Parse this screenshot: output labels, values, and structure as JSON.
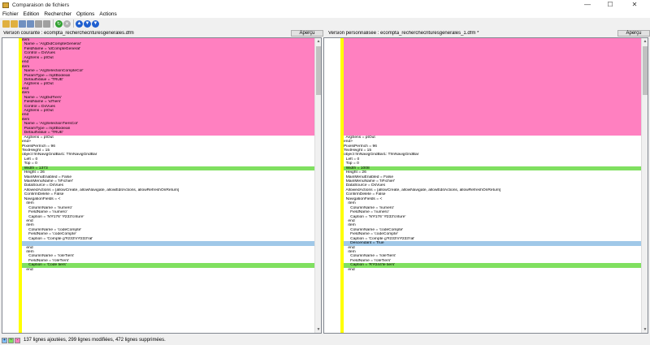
{
  "window": {
    "title": "Comparaison de fichiers",
    "minimize": "—",
    "maximize": "☐",
    "close": "✕"
  },
  "menu": [
    "Fichier",
    "Edition",
    "Rechercher",
    "Options",
    "Actions"
  ],
  "toolbar": {
    "icons": [
      "open-icon",
      "save-icon",
      "save-as-icon",
      "swap-icon",
      "copy-icon",
      "refresh-icon",
      "cancel-icon",
      "prev-diff-icon",
      "next-diff-icon",
      "last-diff-icon"
    ]
  },
  "left": {
    "label": "Version courante : ecompta_recherchecrituresgenerales.dfm",
    "apercu": "Aperçu",
    "lines": [
      {
        "t": "item",
        "bg": "#ff80c0"
      },
      {
        "t": "  Name = 'ArgDidCompteGeneral'",
        "bg": "#ff80c0"
      },
      {
        "t": "  FieldName = 'idCompteGeneral'",
        "bg": "#ff80c0"
      },
      {
        "t": "  Control = DxVues",
        "bg": "#ff80c0"
      },
      {
        "t": "  ArgSens = ptOut",
        "bg": "#ff80c0"
      },
      {
        "t": "end",
        "bg": "#ff80c0"
      },
      {
        "t": "item",
        "bg": "#ff80c0"
      },
      {
        "t": "  Name = 'ArgSelectionCompteCol'",
        "bg": "#ff80c0"
      },
      {
        "t": "  ParamType = mptBoolean",
        "bg": "#ff80c0"
      },
      {
        "t": "  DefaultValue = 'TRUE'",
        "bg": "#ff80c0"
      },
      {
        "t": "  ArgSens = ptOut",
        "bg": "#ff80c0"
      },
      {
        "t": "end",
        "bg": "#ff80c0"
      },
      {
        "t": "item",
        "bg": "#ff80c0"
      },
      {
        "t": "  Name = 'ArgDidTiers'",
        "bg": "#ff80c0"
      },
      {
        "t": "  FieldName = 'idTiers'",
        "bg": "#ff80c0"
      },
      {
        "t": "  Control = DxVues",
        "bg": "#ff80c0"
      },
      {
        "t": "  ArgSens = ptOut",
        "bg": "#ff80c0"
      },
      {
        "t": "end",
        "bg": "#ff80c0"
      },
      {
        "t": "item",
        "bg": "#ff80c0"
      },
      {
        "t": "  Name = 'ArgSelectionTiersCol'",
        "bg": "#ff80c0"
      },
      {
        "t": "  ParamType = mptBoolean",
        "bg": "#ff80c0"
      },
      {
        "t": "  DefaultValue = 'TRUE'",
        "bg": "#ff80c0"
      },
      {
        "t": "  ArgSens = ptOut",
        "bg": ""
      },
      {
        "t": "end>",
        "bg": ""
      },
      {
        "t": "PixelsPerInch = 96",
        "bg": ""
      },
      {
        "t": "TextHeight = 15",
        "bg": ""
      },
      {
        "t": "object fmNavigGridBar1: TfmNavigGridBar",
        "bg": ""
      },
      {
        "t": "  Left = 0",
        "bg": ""
      },
      {
        "t": "  Top = 0",
        "bg": ""
      },
      {
        "t": "  Width = 1373",
        "bg": "#80e060"
      },
      {
        "t": "  Height = 26",
        "bg": ""
      },
      {
        "t": "  MainMenuEnabled = False",
        "bg": ""
      },
      {
        "t": "  MainMenuName = 'fiFichier'",
        "bg": ""
      },
      {
        "t": "  DataSource = DsVues",
        "bg": ""
      },
      {
        "t": "  AllowedActions = [allowCreate, allowNavigate, allowEditActions, allowRefreshOnReturn]",
        "bg": ""
      },
      {
        "t": "  ConfirmDelete = False",
        "bg": ""
      },
      {
        "t": "  NavigationFields = <",
        "bg": ""
      },
      {
        "t": "    item",
        "bg": ""
      },
      {
        "t": "      ColumnName = 'numero'",
        "bg": ""
      },
      {
        "t": "      FieldName = 'numero'",
        "bg": ""
      },
      {
        "t": "      Caption = 'N'#176' '#233'criture'",
        "bg": ""
      },
      {
        "t": "    end",
        "bg": ""
      },
      {
        "t": "    item",
        "bg": ""
      },
      {
        "t": "      ColumnName = 'codeCompte'",
        "bg": ""
      },
      {
        "t": "      FieldName = 'codeCompte'",
        "bg": ""
      },
      {
        "t": "      Caption = 'Compte g'#233'n'#233'ral'",
        "bg": ""
      },
      {
        "t": "",
        "bg": "#a0c8e8"
      },
      {
        "t": "    end",
        "bg": ""
      },
      {
        "t": "    item",
        "bg": ""
      },
      {
        "t": "      ColumnName = 'roleTiers'",
        "bg": ""
      },
      {
        "t": "      FieldName = 'roleTiers'",
        "bg": ""
      },
      {
        "t": "      Caption = 'Code tiers'",
        "bg": "#80e060"
      },
      {
        "t": "    end",
        "bg": ""
      }
    ]
  },
  "right": {
    "label": "Version personnalisée : ecompta_recherchecrituresgenerales_1.dfm *",
    "apercu": "Aperçu",
    "lines": [
      {
        "t": "",
        "bg": "#ff80c0"
      },
      {
        "t": "",
        "bg": "#ff80c0"
      },
      {
        "t": "",
        "bg": "#ff80c0"
      },
      {
        "t": "",
        "bg": "#ff80c0"
      },
      {
        "t": "",
        "bg": "#ff80c0"
      },
      {
        "t": "",
        "bg": "#ff80c0"
      },
      {
        "t": "",
        "bg": "#ff80c0"
      },
      {
        "t": "",
        "bg": "#ff80c0"
      },
      {
        "t": "",
        "bg": "#ff80c0"
      },
      {
        "t": "",
        "bg": "#ff80c0"
      },
      {
        "t": "",
        "bg": "#ff80c0"
      },
      {
        "t": "",
        "bg": "#ff80c0"
      },
      {
        "t": "",
        "bg": "#ff80c0"
      },
      {
        "t": "",
        "bg": "#ff80c0"
      },
      {
        "t": "",
        "bg": "#ff80c0"
      },
      {
        "t": "",
        "bg": "#ff80c0"
      },
      {
        "t": "",
        "bg": "#ff80c0"
      },
      {
        "t": "",
        "bg": "#ff80c0"
      },
      {
        "t": "",
        "bg": "#ff80c0"
      },
      {
        "t": "",
        "bg": "#ff80c0"
      },
      {
        "t": "",
        "bg": "#ff80c0"
      },
      {
        "t": "",
        "bg": "#ff80c0"
      },
      {
        "t": "  ArgSens = ptOut",
        "bg": ""
      },
      {
        "t": "end>",
        "bg": ""
      },
      {
        "t": "PixelsPerInch = 96",
        "bg": ""
      },
      {
        "t": "TextHeight = 15",
        "bg": ""
      },
      {
        "t": "object fmNavigGridBar1: TfmNavigGridBar",
        "bg": ""
      },
      {
        "t": "  Left = 0",
        "bg": ""
      },
      {
        "t": "  Top = 0",
        "bg": ""
      },
      {
        "t": "  Width = 1008",
        "bg": "#80e060"
      },
      {
        "t": "  Height = 26",
        "bg": ""
      },
      {
        "t": "  MainMenuEnabled = False",
        "bg": ""
      },
      {
        "t": "  MainMenuName = 'fiFichier'",
        "bg": ""
      },
      {
        "t": "  DataSource = DsVues",
        "bg": ""
      },
      {
        "t": "  AllowedActions = [allowCreate, allowNavigate, allowEditActions, allowRefreshOnReturn]",
        "bg": ""
      },
      {
        "t": "  ConfirmDelete = False",
        "bg": ""
      },
      {
        "t": "  NavigationFields = <",
        "bg": ""
      },
      {
        "t": "    item",
        "bg": ""
      },
      {
        "t": "      ColumnName = 'numero'",
        "bg": ""
      },
      {
        "t": "      FieldName = 'numero'",
        "bg": ""
      },
      {
        "t": "      Caption = 'N'#176' '#233'criture'",
        "bg": ""
      },
      {
        "t": "    end",
        "bg": ""
      },
      {
        "t": "    item",
        "bg": ""
      },
      {
        "t": "      ColumnName = 'codeCompte'",
        "bg": ""
      },
      {
        "t": "      FieldName = 'codeCompte'",
        "bg": ""
      },
      {
        "t": "      Caption = 'Compte g'#233'n'#233'ral'",
        "bg": ""
      },
      {
        "t": "      Descendant = True",
        "bg": "#a0c8e8"
      },
      {
        "t": "    end",
        "bg": ""
      },
      {
        "t": "    item",
        "bg": ""
      },
      {
        "t": "      ColumnName = 'roleTiers'",
        "bg": ""
      },
      {
        "t": "      FieldName = 'roleTiers'",
        "bg": ""
      },
      {
        "t": "      Caption = 'R'#244'le tiers'",
        "bg": "#80e060"
      },
      {
        "t": "    end",
        "bg": ""
      }
    ]
  },
  "status": {
    "text": "137 lignes ajoutées, 299 lignes modifiées, 472 lignes supprimées.",
    "legend": [
      {
        "sym": "+",
        "color": "#80c0ff"
      },
      {
        "sym": "~",
        "color": "#80e060"
      },
      {
        "sym": "-",
        "color": "#ff80c0"
      }
    ]
  }
}
